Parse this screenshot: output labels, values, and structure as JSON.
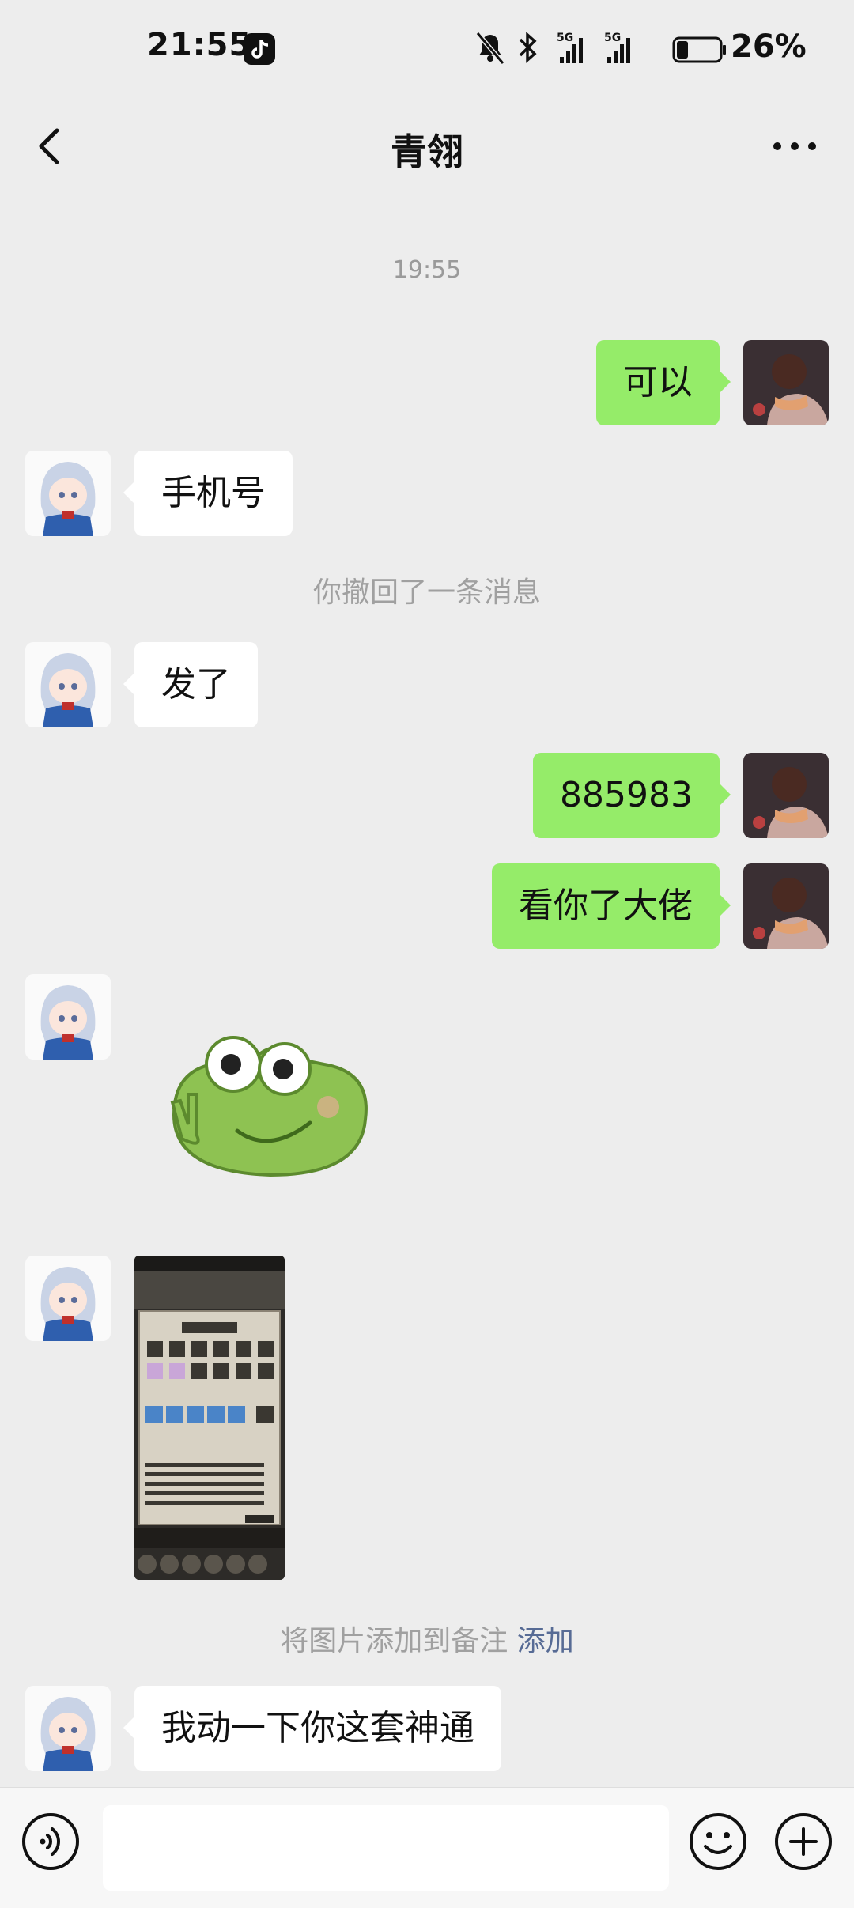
{
  "status_bar": {
    "time": "21:55",
    "battery": "26%",
    "network_1": "5G",
    "network_2": "5G"
  },
  "header": {
    "title": "青翎",
    "back_icon": "chevron-left-icon",
    "more_icon": "ellipsis-icon"
  },
  "chat": {
    "timestamp": "19:55",
    "messages": [
      {
        "side": "out",
        "type": "text",
        "text": "可以"
      },
      {
        "side": "in",
        "type": "text",
        "text": "手机号"
      },
      {
        "side": "system",
        "type": "system",
        "text": "你撤回了一条消息"
      },
      {
        "side": "in",
        "type": "text",
        "text": "发了"
      },
      {
        "side": "out",
        "type": "text",
        "text": "885983"
      },
      {
        "side": "out",
        "type": "text",
        "text": "看你了大佬"
      },
      {
        "side": "in",
        "type": "sticker",
        "icon": "frog-sticker"
      },
      {
        "side": "in",
        "type": "image",
        "icon": "game-screenshot-image"
      },
      {
        "side": "system",
        "type": "system",
        "text": "将图片添加到备注",
        "link": "添加"
      },
      {
        "side": "in",
        "type": "text",
        "text": "我动一下你这套神通"
      }
    ]
  },
  "input_bar": {
    "voice_icon": "voice-icon",
    "input_value": "",
    "emoji_icon": "emoji-icon",
    "plus_icon": "plus-icon"
  },
  "colors": {
    "background": "#ededed",
    "bubble_out": "#95ec69",
    "bubble_in": "#ffffff",
    "link": "#576b95"
  }
}
